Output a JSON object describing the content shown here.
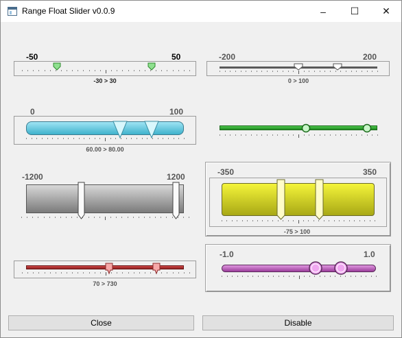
{
  "window": {
    "title": "Range Float Slider v0.0.9",
    "icon": "window-app-icon",
    "minimize_glyph": "–",
    "maximize_glyph": "☐",
    "close_glyph": "✕"
  },
  "sliders": [
    {
      "min_label": "-50",
      "max_label": "50",
      "range_text": "-30 > 30",
      "min": -50,
      "max": 50,
      "low": -30,
      "high": 30,
      "thumb": "green-tab"
    },
    {
      "min_label": "-200",
      "max_label": "200",
      "range_text": "0 > 100",
      "min": -200,
      "max": 200,
      "low": 0,
      "high": 100,
      "thumb": "white-pentagon"
    },
    {
      "min_label": "0",
      "max_label": "100",
      "range_text": "60.00 > 80.00",
      "min": 0,
      "max": 100,
      "low": 60,
      "high": 80,
      "thumb": "cyan-triangle"
    },
    {
      "min_label": "",
      "max_label": "",
      "range_text": "",
      "min": 0,
      "max": 100,
      "low": 55,
      "high": 95,
      "thumb": "green-circle"
    },
    {
      "min_label": "-1200",
      "max_label": "1200",
      "range_text": "",
      "min": -1200,
      "max": 1200,
      "low": -400,
      "high": 1100,
      "thumb": "white-bar"
    },
    {
      "min_label": "-350",
      "max_label": "350",
      "range_text": "-75 > 100",
      "min": -350,
      "max": 350,
      "low": -75,
      "high": 100,
      "thumb": "cream-pointer"
    },
    {
      "min_label": "",
      "max_label": "",
      "range_text": "70 > 730",
      "min": 0,
      "max": 1000,
      "low": 70,
      "high": 730,
      "thumb": "pink-square"
    },
    {
      "min_label": "-1.0",
      "max_label": "1.0",
      "range_text": "",
      "min": -1.0,
      "max": 1.0,
      "low": 0.3,
      "high": 0.7,
      "thumb": "pink-circle"
    }
  ],
  "buttons": {
    "close_label": "Close",
    "disable_label": "Disable"
  }
}
